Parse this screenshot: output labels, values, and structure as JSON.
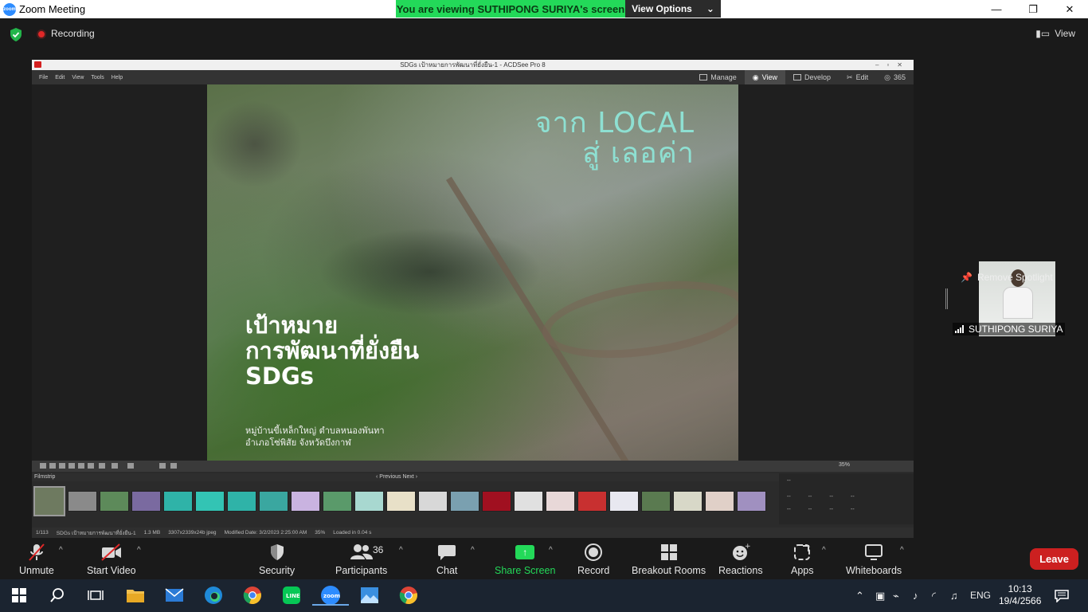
{
  "window": {
    "title": "Zoom Meeting",
    "controls": [
      "—",
      "❐",
      "✕"
    ]
  },
  "banner": {
    "viewing_text": "You are viewing SUTHIPONG SURIYA's screen",
    "view_options": "View Options"
  },
  "topbar": {
    "recording_label": "Recording",
    "view_label": "View"
  },
  "shared_screen": {
    "acdsee_title": "SDGs เป้าหมายการพัฒนาที่ยั่งยืน-1 - ACDSee Pro 8",
    "menu": [
      "File",
      "Edit",
      "View",
      "Tools",
      "Help"
    ],
    "modes": [
      {
        "label": "Manage",
        "active": false
      },
      {
        "label": "View",
        "active": true
      },
      {
        "label": "Develop",
        "active": false
      },
      {
        "label": "Edit",
        "active": false
      },
      {
        "label": "365",
        "active": false
      }
    ],
    "photo": {
      "headline_line1": "จาก LOCAL",
      "headline_line2": "สู่ เลอค่า",
      "goal_line1": "เป้าหมาย",
      "goal_line2": "การพัฒนาที่ยั่งยืน",
      "goal_line3": "SDGs",
      "caption_line1": "หมู่บ้านขี้เหล็กใหญ่ ตำบลหนองพันทา",
      "caption_line2": "อำเภอโซ่พิสัย จังหวัดบึงกาฬ"
    },
    "zoom_level": "35%",
    "filmstrip_label": "Filmstrip",
    "filmstrip_nav": "‹ Previous      Next ›",
    "thumbnail_colors": [
      "#6e7a60",
      "#8a8a8a",
      "#5d8a5a",
      "#7a6aa0",
      "#2fb3a8",
      "#33c4b4",
      "#2fb3a8",
      "#3aa7a0",
      "#c9b3e0",
      "#5a9a6a",
      "#a8d8d0",
      "#e8e0c8",
      "#d8d8d8",
      "#7aa0b0",
      "#a01020",
      "#e0e0e0",
      "#e8d8d8",
      "#c83030",
      "#e8e8f0",
      "#5a7a50",
      "#d8d8c8",
      "#e0d0c8",
      "#a090c0"
    ],
    "meta_values": [
      "--",
      "--",
      "--",
      "--",
      "--"
    ],
    "status": {
      "index": "1/113",
      "filename": "SDGs เป้าหมายการพัฒนาที่ยั่งยืน-1",
      "size": "1.3 MB",
      "dims": "3307x2339x24b jpeg",
      "modified": "Modified Date: 3/2/2023 2:25:00 AM",
      "zoom": "35%",
      "loaded": "Loaded in 0.04 s"
    }
  },
  "spotlight": {
    "remove_label": "Remove Spotlight",
    "participant_name": "SUTHIPONG SURIYA"
  },
  "toolbar": {
    "unmute": "Unmute",
    "start_video": "Start Video",
    "security": "Security",
    "participants": "Participants",
    "participants_count": "36",
    "chat": "Chat",
    "share_screen": "Share Screen",
    "record": "Record",
    "breakout": "Breakout Rooms",
    "reactions": "Reactions",
    "apps": "Apps",
    "whiteboards": "Whiteboards",
    "leave": "Leave"
  },
  "taskbar": {
    "language": "ENG",
    "time": "10:13",
    "date": "19/4/2566"
  },
  "colors": {
    "zoom_green": "#23d959",
    "leave_red": "#cc2020",
    "zoom_blue": "#2d8cff"
  }
}
